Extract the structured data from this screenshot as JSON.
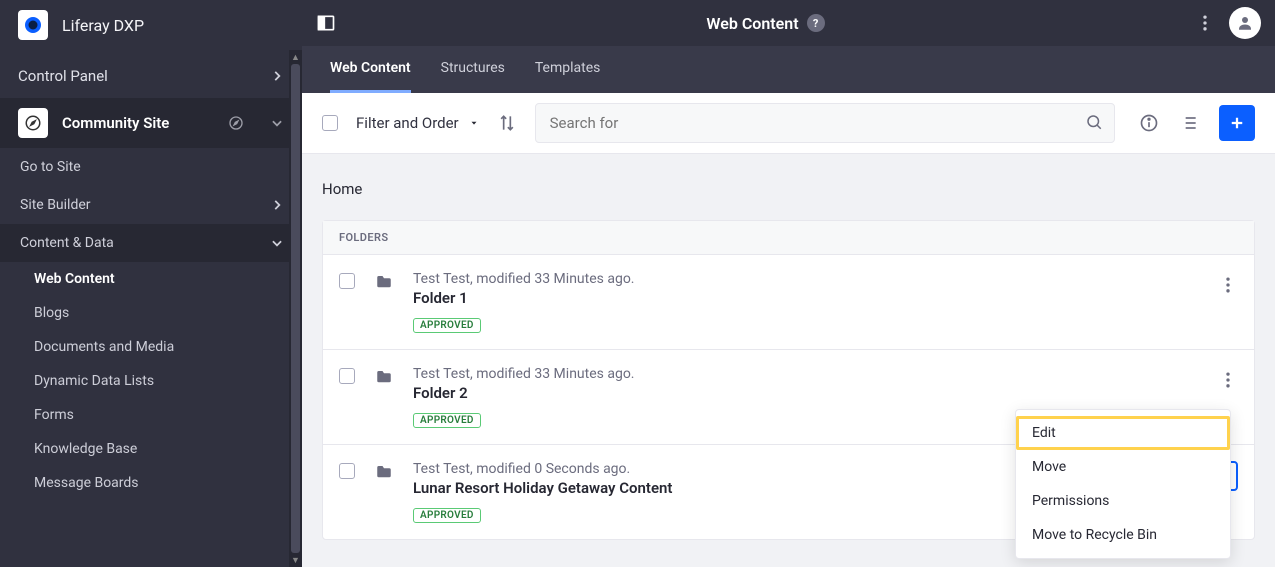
{
  "brand": {
    "name": "Liferay DXP"
  },
  "sidebar": {
    "control_panel": "Control Panel",
    "site": {
      "label": "Community Site"
    },
    "go_to_site": "Go to Site",
    "site_builder": "Site Builder",
    "content_data": "Content & Data",
    "leaves": {
      "web_content": "Web Content",
      "blogs": "Blogs",
      "documents_media": "Documents and Media",
      "dynamic_data_lists": "Dynamic Data Lists",
      "forms": "Forms",
      "knowledge_base": "Knowledge Base",
      "message_boards": "Message Boards"
    }
  },
  "topbar": {
    "title": "Web Content"
  },
  "tabs": {
    "web_content": "Web Content",
    "structures": "Structures",
    "templates": "Templates"
  },
  "toolbar": {
    "filter_label": "Filter and Order",
    "search_placeholder": "Search for"
  },
  "breadcrumb": "Home",
  "folders": {
    "section_label": "FOLDERS",
    "items": [
      {
        "meta": "Test Test, modified 33 Minutes ago.",
        "title": "Folder 1",
        "status": "APPROVED"
      },
      {
        "meta": "Test Test, modified 33 Minutes ago.",
        "title": "Folder 2",
        "status": "APPROVED"
      },
      {
        "meta": "Test Test, modified 0 Seconds ago.",
        "title": "Lunar Resort Holiday Getaway Content",
        "status": "APPROVED"
      }
    ]
  },
  "context_menu": {
    "edit": "Edit",
    "move": "Move",
    "permissions": "Permissions",
    "recycle": "Move to Recycle Bin"
  }
}
